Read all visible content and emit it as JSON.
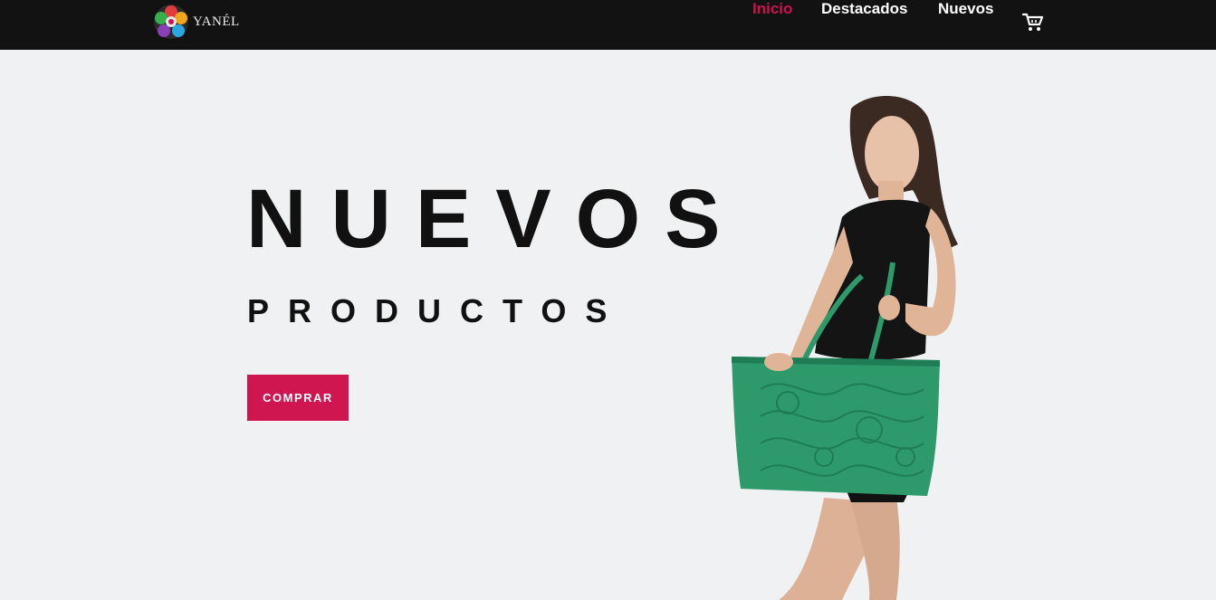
{
  "brand": {
    "name": "YANÉL",
    "icon": "mandala-logo"
  },
  "nav": {
    "items": [
      {
        "label": "Inicio",
        "active": true
      },
      {
        "label": "Destacados",
        "active": false
      },
      {
        "label": "Nuevos",
        "active": false
      }
    ],
    "cart_icon": "shopping-cart-icon"
  },
  "hero": {
    "title": "NUEVOS",
    "subtitle": "PRODUCTOS",
    "cta_label": "COMPRAR",
    "image": "woman holding green tooled leather tote bag"
  },
  "colors": {
    "accent": "#cf1651",
    "nav_bg": "#121212",
    "page_bg": "#eff1f2",
    "bag": "#2e9a6c"
  }
}
